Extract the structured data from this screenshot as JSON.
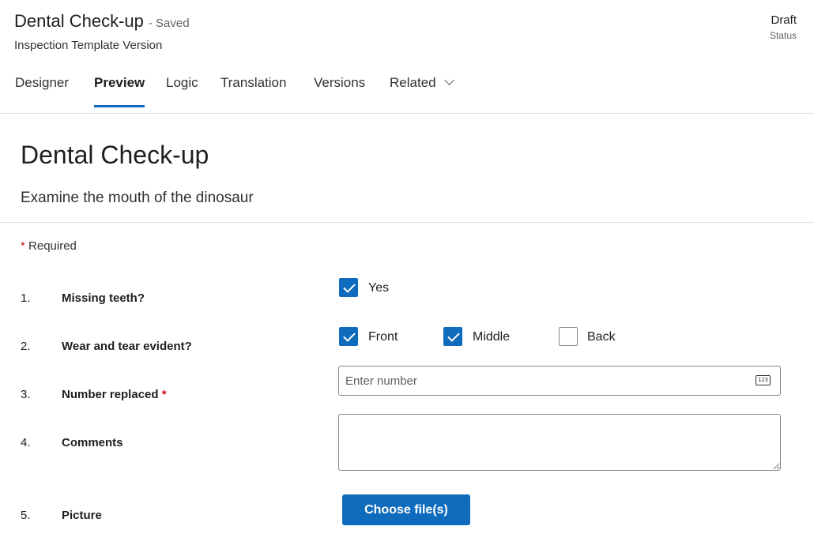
{
  "header": {
    "title": "Dental Check-up",
    "saved_status": "- Saved",
    "subtitle": "Inspection Template Version",
    "status_value": "Draft",
    "status_label": "Status"
  },
  "tabs": [
    {
      "label": "Designer"
    },
    {
      "label": "Preview",
      "active": true
    },
    {
      "label": "Logic"
    },
    {
      "label": "Translation"
    },
    {
      "label": "Versions"
    },
    {
      "label": "Related"
    }
  ],
  "form": {
    "title": "Dental Check-up",
    "description": "Examine the mouth of the dinosaur",
    "required_marker": "*",
    "required_note": "Required",
    "questions": [
      {
        "number": "1.",
        "label": "Missing teeth?",
        "options": [
          {
            "label": "Yes",
            "checked": true
          }
        ]
      },
      {
        "number": "2.",
        "label": "Wear and tear evident?",
        "options": [
          {
            "label": "Front",
            "checked": true
          },
          {
            "label": "Middle",
            "checked": true
          },
          {
            "label": "Back",
            "checked": false
          }
        ]
      },
      {
        "number": "3.",
        "label": "Number replaced",
        "required": "*",
        "placeholder": "Enter number",
        "icon": "number-icon",
        "icon_text": "123"
      },
      {
        "number": "4.",
        "label": "Comments"
      },
      {
        "number": "5.",
        "label": "Picture",
        "button_label": "Choose file(s)"
      }
    ]
  },
  "colors": {
    "accent": "#0f6cbd",
    "required": "#c50f1f",
    "border": "#8a8886"
  }
}
